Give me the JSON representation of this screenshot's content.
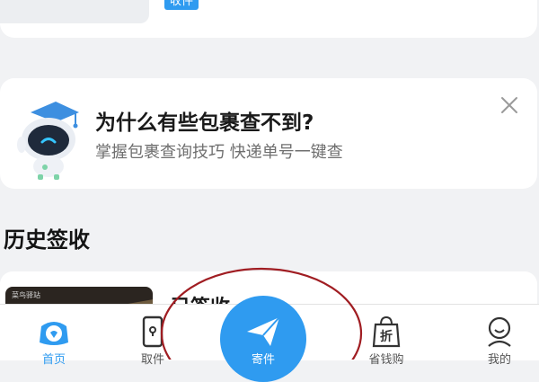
{
  "top_card": {
    "tag": "收件"
  },
  "tip": {
    "title": "为什么有些包裹查不到?",
    "subtitle": "掌握包裹查询技巧 快递单号一键查"
  },
  "history": {
    "section_title": "历史签收",
    "status": "已签收",
    "thumb_brand": "菜鸟驿站"
  },
  "tabbar": {
    "tabs": [
      {
        "label": "首页",
        "icon": "mascot-icon",
        "active": true
      },
      {
        "label": "取件",
        "icon": "locker-icon",
        "active": false
      },
      {
        "label": "寄件",
        "icon": "paper-plane-icon",
        "active": false
      },
      {
        "label": "省钱购",
        "icon": "discount-bag-icon",
        "active": false
      },
      {
        "label": "我的",
        "icon": "profile-icon",
        "active": false
      }
    ]
  },
  "colors": {
    "accent": "#2f9bf0",
    "annotation": "#a01d22"
  }
}
